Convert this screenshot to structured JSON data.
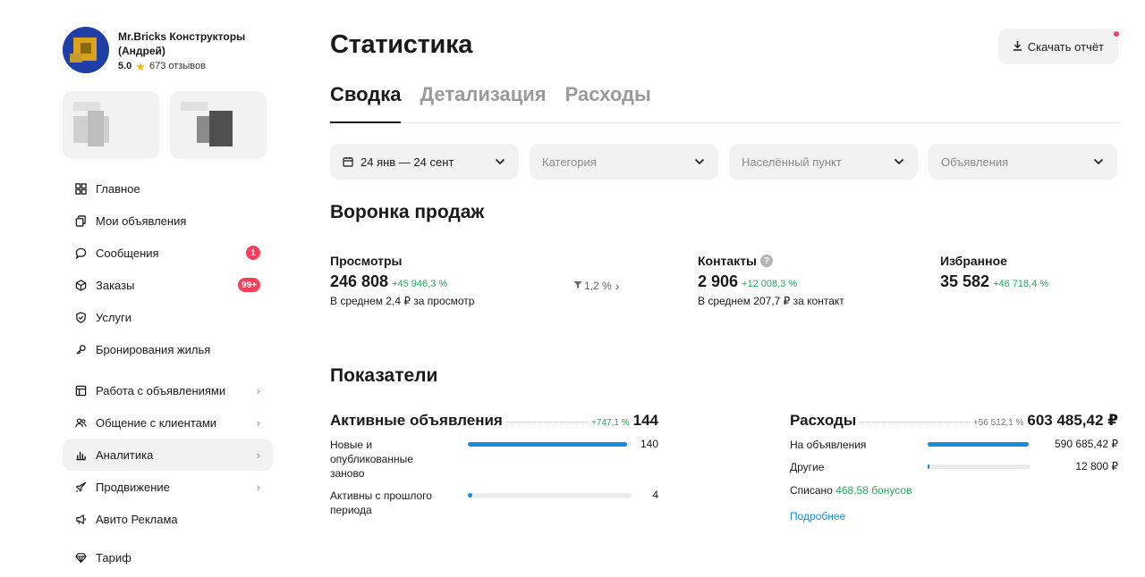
{
  "profile": {
    "name": "Mr.Bricks Конструкторы (Андрей)",
    "rating": "5.0",
    "reviews": "673 отзывов"
  },
  "sidebar": {
    "items": [
      {
        "label": "Главное",
        "icon": "grid-icon"
      },
      {
        "label": "Мои объявления",
        "icon": "copy-icon"
      },
      {
        "label": "Сообщения",
        "icon": "chat-icon",
        "badge": "1"
      },
      {
        "label": "Заказы",
        "icon": "box-icon",
        "badge": "99+"
      },
      {
        "label": "Услуги",
        "icon": "shield-icon"
      },
      {
        "label": "Бронирования жилья",
        "icon": "key-icon"
      },
      {
        "label": "Работа с объявлениями",
        "icon": "layout-icon"
      },
      {
        "label": "Общение с клиентами",
        "icon": "users-icon"
      },
      {
        "label": "Аналитика",
        "icon": "bar-chart-icon"
      },
      {
        "label": "Продвижение",
        "icon": "rocket-icon"
      },
      {
        "label": "Авито Реклама",
        "icon": "megaphone-icon"
      },
      {
        "label": "Тариф",
        "icon": "diamond-icon"
      }
    ]
  },
  "header": {
    "title": "Статистика",
    "download_label": "Скачать отчёт"
  },
  "tabs": [
    {
      "label": "Сводка",
      "active": true
    },
    {
      "label": "Детализация",
      "active": false
    },
    {
      "label": "Расходы",
      "active": false
    }
  ],
  "filters": {
    "date_range": "24 янв — 24 сент",
    "category": "Категория",
    "city": "Населённый пункт",
    "ads": "Объявления"
  },
  "funnel": {
    "title": "Воронка продаж",
    "views": {
      "label": "Просмотры",
      "value": "246 808",
      "delta": "+45 946,3 %",
      "sub": "В среднем 2,4 ₽ за просмотр"
    },
    "conversion": "1,2 %",
    "contacts": {
      "label": "Контакты",
      "value": "2 906",
      "delta": "+12 008,3 %",
      "sub": "В среднем 207,7 ₽ за контакт"
    },
    "favorites": {
      "label": "Избранное",
      "value": "35 582",
      "delta": "+46 718,4 %"
    }
  },
  "indicators": {
    "title": "Показатели",
    "active_ads": {
      "label": "Активные объявления",
      "delta": "+747,1 %",
      "value": "144",
      "rows": [
        {
          "label": "Новые и опубликованные заново",
          "value": "140",
          "fill": 0.972
        },
        {
          "label": "Активны с прошлого периода",
          "value": "4",
          "fill": 0.028
        }
      ]
    },
    "expenses": {
      "label": "Расходы",
      "delta": "+56 512,1 %",
      "value": "603 485,42 ₽",
      "rows": [
        {
          "label": "На объявления",
          "value": "590 685,42 ₽",
          "fill": 0.979
        },
        {
          "label": "Другие",
          "value": "12 800 ₽",
          "fill": 0.021
        }
      ],
      "spent_prefix": "Списано",
      "spent_bonus": "468,58 бонусов",
      "more_link": "Подробнее"
    }
  },
  "colors": {
    "accent_blue": "#1a8bdc",
    "positive_green": "#27a65a",
    "badge_red": "#f4405a",
    "star_yellow": "#f5b400"
  }
}
